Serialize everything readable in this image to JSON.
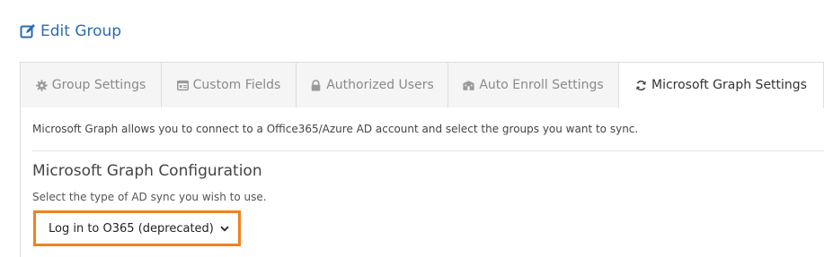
{
  "header": {
    "title": "Edit Group",
    "icon": "edit-icon",
    "color": "#2a6db0"
  },
  "tabs": [
    {
      "label": "Group Settings",
      "icon": "gear-icon",
      "active": false
    },
    {
      "label": "Custom Fields",
      "icon": "id-card-icon",
      "active": false
    },
    {
      "label": "Authorized Users",
      "icon": "lock-icon",
      "active": false
    },
    {
      "label": "Auto Enroll Settings",
      "icon": "building-icon",
      "active": false
    },
    {
      "label": "Microsoft Graph Settings",
      "icon": "refresh-icon",
      "active": true
    }
  ],
  "main": {
    "intro": "Microsoft Graph allows you to connect to a Office365/Azure AD account and select the groups you want to sync.",
    "section_title": "Microsoft Graph Configuration",
    "help_text": "Select the type of AD sync you wish to use.",
    "sync_type_select": {
      "value": "Log in to O365 (deprecated)",
      "highlight_color": "#f0821e"
    }
  }
}
